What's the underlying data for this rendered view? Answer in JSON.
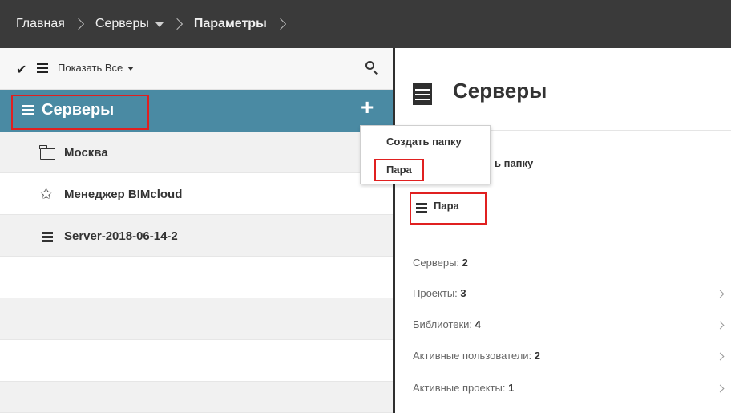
{
  "breadcrumb": {
    "items": [
      "Главная",
      "Серверы",
      "Параметры"
    ]
  },
  "toolbar": {
    "filter_label": "Показать Все"
  },
  "tree": {
    "selected_label": "Серверы",
    "rows": [
      "Москва",
      "Менеджер BIMcloud",
      "Server-2018-06-14-2"
    ]
  },
  "popup": {
    "create_folder": "Создать папку",
    "pair": "Пара"
  },
  "details": {
    "title": "Серверы",
    "create_folder_partial": "ь папку",
    "pair_label": "Пара",
    "stats": [
      {
        "label": "Серверы: ",
        "value": "2"
      },
      {
        "label": "Проекты: ",
        "value": "3"
      },
      {
        "label": "Библиотеки: ",
        "value": "4"
      },
      {
        "label": "Активные пользователи: ",
        "value": "2"
      },
      {
        "label": "Активные проекты: ",
        "value": "1"
      }
    ]
  },
  "colors": {
    "topbar": "#3a3a3a",
    "selected_row": "#4a8aa3",
    "highlight_box": "#e02020"
  },
  "icons": [
    "check-icon",
    "menu-icon",
    "search-icon",
    "server-icon",
    "plus-icon",
    "folder-icon",
    "manager-icon",
    "chevron-right-icon"
  ]
}
